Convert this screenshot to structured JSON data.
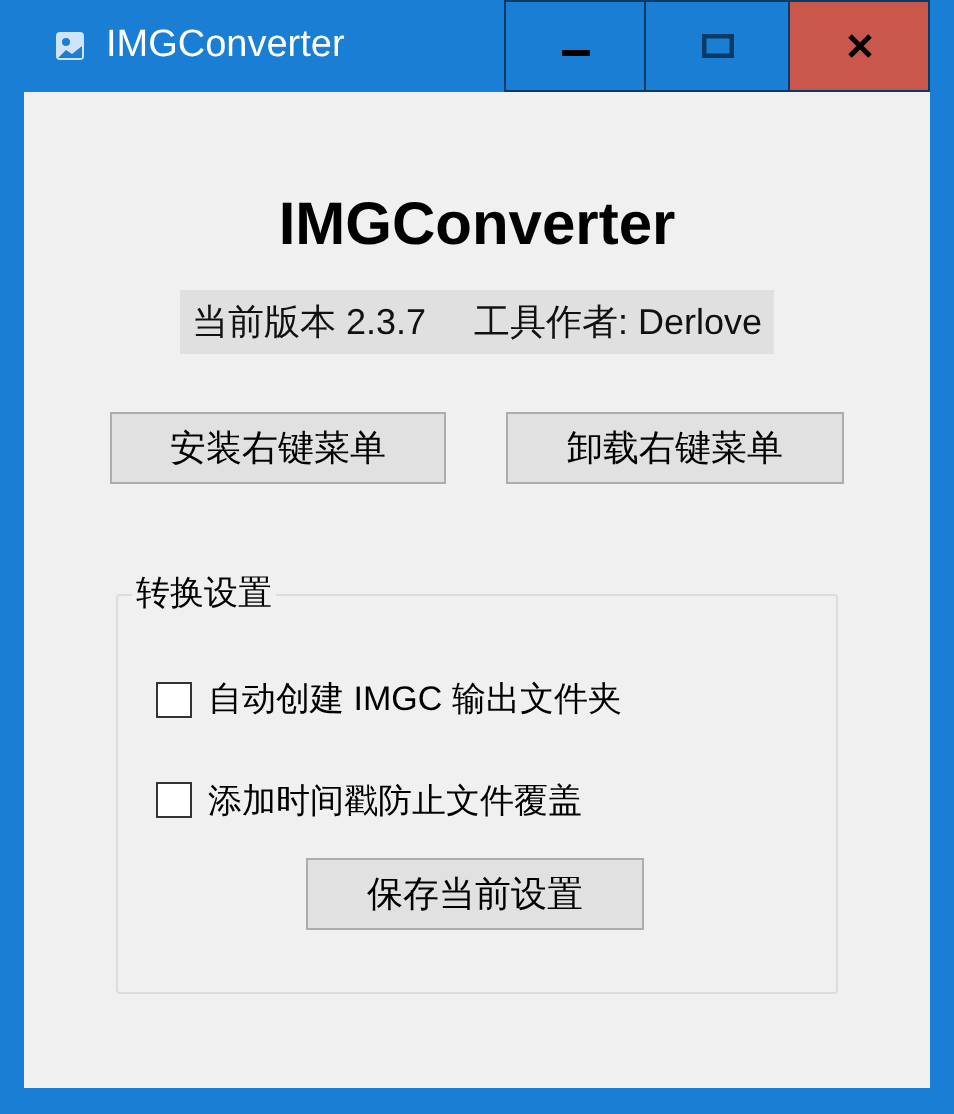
{
  "window": {
    "title": "IMGConverter"
  },
  "heading": "IMGConverter",
  "info": [
    "当前版本 2.3.7",
    "工具作者: Derlove"
  ],
  "buttons": [
    "安装右键菜单",
    "卸载右键菜单"
  ],
  "settings": {
    "title": "转换设置",
    "options": [
      {
        "label": "自动创建 IMGC 输出文件夹",
        "checked": false
      },
      {
        "label": "添加时间戳防止文件覆盖",
        "checked": false
      }
    ],
    "save_button": "保存当前设置"
  }
}
